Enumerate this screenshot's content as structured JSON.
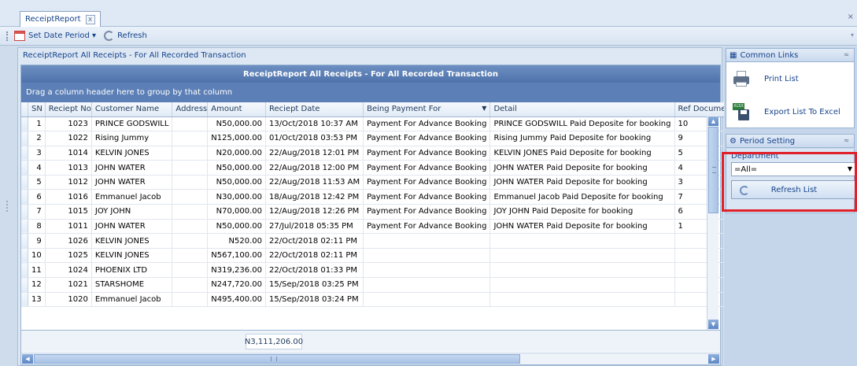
{
  "tab": {
    "label": "ReceiptReport",
    "close_glyph": "x"
  },
  "toolbar": {
    "set_date_period_label": "Set Date Period ▾",
    "refresh_label": "Refresh"
  },
  "report": {
    "title": "ReceiptReport All Receipts - For All Recorded Transaction",
    "grid_caption": "ReceiptReport All Receipts - For All Recorded Transaction",
    "group_panel_hint": "Drag a column header here to group by that column"
  },
  "grid": {
    "columns": [
      "SN",
      "Reciept No",
      "Customer Name",
      "Address",
      "Amount",
      "Reciept Date",
      "Being Payment For",
      "Detail",
      "Ref Document"
    ],
    "rows": [
      [
        "1",
        "1023",
        "PRINCE GODSWILL",
        "",
        "N50,000.00",
        "13/Oct/2018 10:37 AM",
        "Payment For Advance Booking",
        "PRINCE GODSWILL Paid Deposite for booking",
        "10"
      ],
      [
        "2",
        "1022",
        "Rising Jummy",
        "",
        "N125,000.00",
        "01/Oct/2018 03:53 PM",
        "Payment For Advance Booking",
        "Rising Jummy Paid Deposite for booking",
        "9"
      ],
      [
        "3",
        "1014",
        "KELVIN JONES",
        "",
        "N20,000.00",
        "22/Aug/2018 12:01 PM",
        "Payment For Advance Booking",
        "KELVIN JONES Paid Deposite for booking",
        "5"
      ],
      [
        "4",
        "1013",
        "JOHN WATER",
        "",
        "N50,000.00",
        "22/Aug/2018 12:00 PM",
        "Payment For Advance Booking",
        "JOHN WATER Paid Deposite for booking",
        "4"
      ],
      [
        "5",
        "1012",
        "JOHN WATER",
        "",
        "N50,000.00",
        "22/Aug/2018 11:53 AM",
        "Payment For Advance Booking",
        "JOHN WATER Paid Deposite for booking",
        "3"
      ],
      [
        "6",
        "1016",
        "Emmanuel Jacob",
        "",
        "N30,000.00",
        "18/Aug/2018 12:42 PM",
        "Payment For Advance Booking",
        "Emmanuel Jacob Paid Deposite for booking",
        "7"
      ],
      [
        "7",
        "1015",
        "JOY JOHN",
        "",
        "N70,000.00",
        "12/Aug/2018 12:26 PM",
        "Payment For Advance Booking",
        "JOY JOHN Paid Deposite for booking",
        "6"
      ],
      [
        "8",
        "1011",
        "JOHN WATER",
        "",
        "N50,000.00",
        "27/Jul/2018 05:35 PM",
        "Payment For Advance Booking",
        "JOHN WATER Paid Deposite for booking",
        "1"
      ],
      [
        "9",
        "1026",
        "KELVIN JONES",
        "",
        "N520.00",
        "22/Oct/2018 02:11 PM",
        "",
        "",
        ""
      ],
      [
        "10",
        "1025",
        "KELVIN JONES",
        "",
        "N567,100.00",
        "22/Oct/2018 02:11 PM",
        "",
        "",
        ""
      ],
      [
        "11",
        "1024",
        "PHOENIX LTD",
        "",
        "N319,236.00",
        "22/Oct/2018 01:33 PM",
        "",
        "",
        ""
      ],
      [
        "12",
        "1021",
        "STARSHOME",
        "",
        "N247,720.00",
        "15/Sep/2018 03:25 PM",
        "",
        "",
        ""
      ],
      [
        "13",
        "1020",
        "Emmanuel Jacob",
        "",
        "N495,400.00",
        "15/Sep/2018 03:24 PM",
        "",
        "",
        ""
      ]
    ],
    "total_amount": "N3,111,206.00"
  },
  "right_panel": {
    "common_links_title": "Common Links",
    "print_list_label": "Print List",
    "export_label": "Export List To Excel",
    "excel_badge": "XLSX",
    "period_setting_title": "Period Setting",
    "department_label": "Department",
    "department_value": "=All=",
    "refresh_list_label": "Refresh List"
  },
  "colors": {
    "caption_blue": "#5b7fb6",
    "highlight_red": "#e0202a"
  }
}
